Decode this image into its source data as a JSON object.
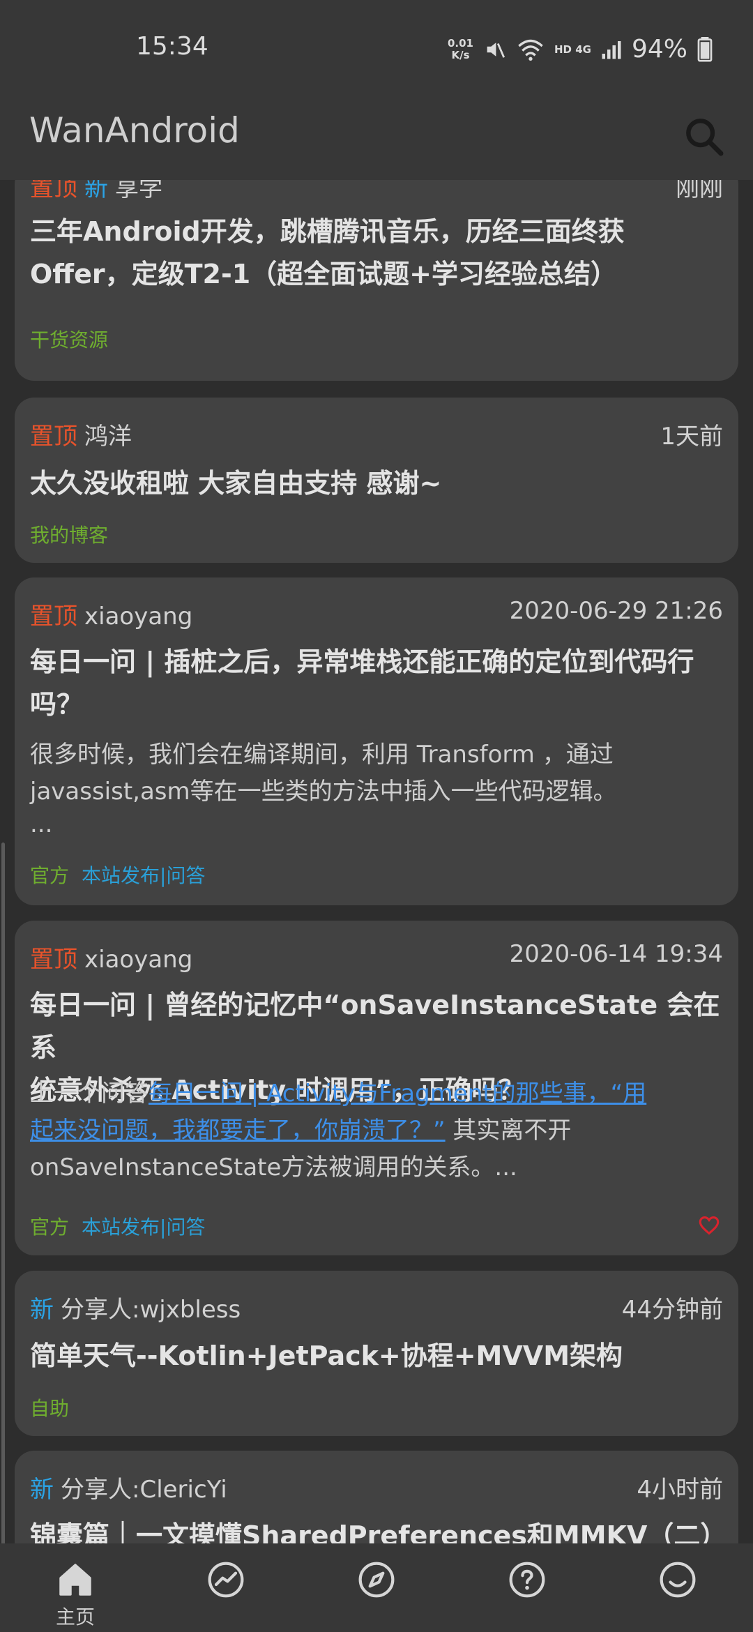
{
  "status_bar": {
    "time": "15:34",
    "net_speed_value": "0.01",
    "net_speed_unit": "K/s",
    "network": "HD 4G",
    "battery": "94%",
    "icons": [
      "mute-icon",
      "wifi-icon",
      "signal-icon",
      "battery-icon"
    ]
  },
  "app_bar": {
    "title": "WanAndroid",
    "search_icon": "search-icon"
  },
  "colors": {
    "top_tag": "#e8532b",
    "new_tag": "#2ba3e6",
    "chapter": "#6fae2f",
    "link": "#3d8fe8",
    "heart": "#d9232d"
  },
  "articles": [
    {
      "tag_top": "置顶",
      "tag_new": "新",
      "author": "享学",
      "time": "刚刚",
      "title_lines": [
        "三年Android开发，跳槽腾讯音乐，历经三面终获",
        "Offer，定级T2-1（超全面试题+学习经验总结）"
      ],
      "chapter": "干货资源"
    },
    {
      "tag_top": "置顶",
      "author": "鸿洋",
      "time": "1天前",
      "title": "太久没收租啦 大家自由支持 感谢~",
      "chapter": "我的博客"
    },
    {
      "tag_top": "置顶",
      "author": "xiaoyang",
      "time": "2020-06-29 21:26",
      "title_lines": [
        "每日一问 | 插桩之后，异常堆栈还能正确的定位到代码行",
        "吗？"
      ],
      "desc_lines": [
        "很多时候，我们会在编译期间，利用 Transform ，通过",
        "javassist,asm等在一些类的方法中插入一些代码逻辑。",
        "..."
      ],
      "chapter": "官方",
      "site": "本站发布|问答"
    },
    {
      "tag_top": "置顶",
      "author": "xiaoyang",
      "time": "2020-06-14 19:34",
      "title_lines": [
        "每日一问 | 曾经的记忆中“onSaveInstanceState 会在系",
        "统意外杀死 Activity 时调用”，正确吗？"
      ],
      "desc_prefix": "上一个问答",
      "desc_link_1": "每日一问 | Activity与Fragment的那些事，“用",
      "desc_link_2": "起来没问题，我都要走了，你崩溃了？”",
      "desc_suffix": " 其实离不开",
      "desc_line_3": "onSaveInstanceState方法被调用的关系。...",
      "chapter": "官方",
      "site": "本站发布|问答",
      "heart_icon": "heart-outline-icon"
    },
    {
      "tag_new": "新",
      "author": "分享人:wjxbless",
      "time": "44分钟前",
      "title": "简单天气--Kotlin+JetPack+协程+MVVM架构",
      "chapter": "自助"
    },
    {
      "tag_new": "新",
      "author": "分享人:ClericYi",
      "time": "4小时前",
      "title": "锦囊篇｜一文摸懂SharedPreferences和MMKV（二）"
    }
  ],
  "bottom_nav": [
    {
      "label": "主页",
      "icon": "home-icon",
      "active": true
    },
    {
      "label": "",
      "icon": "trending-icon"
    },
    {
      "label": "",
      "icon": "compass-icon"
    },
    {
      "label": "",
      "icon": "question-icon"
    },
    {
      "label": "",
      "icon": "smile-icon"
    }
  ]
}
